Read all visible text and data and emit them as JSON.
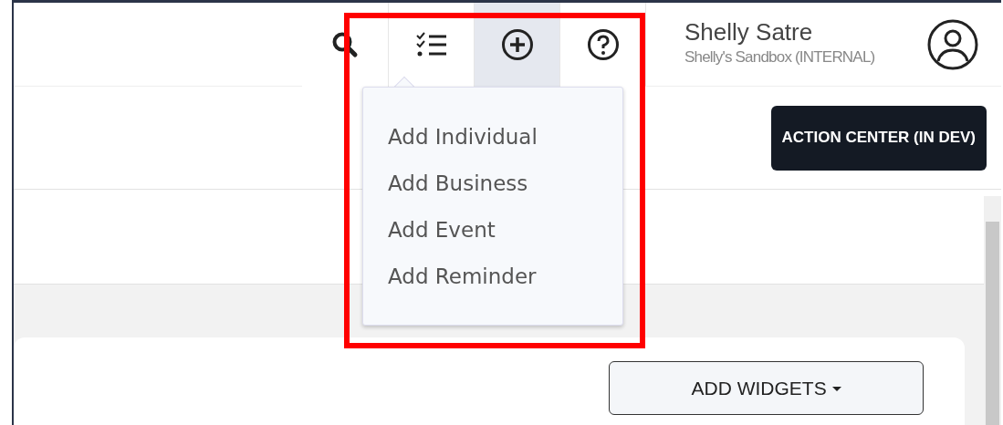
{
  "header": {
    "buttons": [
      {
        "kind": "search",
        "selected": false
      },
      {
        "kind": "tasks",
        "selected": false
      },
      {
        "kind": "add",
        "selected": true
      },
      {
        "kind": "help",
        "selected": false
      }
    ],
    "user": {
      "name": "Shelly Satre",
      "organization": "Shelly's Sandbox (INTERNAL)"
    }
  },
  "add_menu": {
    "items": [
      "Add Individual",
      "Add Business",
      "Add Event",
      "Add Reminder"
    ]
  },
  "action_button": "ACTION CENTER (IN DEV)",
  "widgets_button": "ADD WIDGETS",
  "highlight": {
    "color": "#ff0000"
  }
}
